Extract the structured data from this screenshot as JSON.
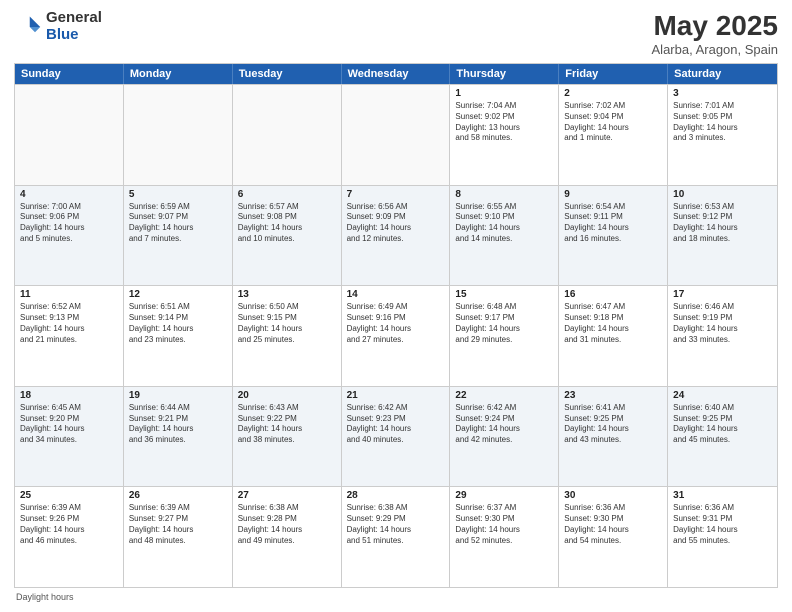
{
  "logo": {
    "general": "General",
    "blue": "Blue"
  },
  "title": "May 2025",
  "subtitle": "Alarba, Aragon, Spain",
  "days": [
    "Sunday",
    "Monday",
    "Tuesday",
    "Wednesday",
    "Thursday",
    "Friday",
    "Saturday"
  ],
  "footer": "Daylight hours",
  "weeks": [
    [
      {
        "day": "",
        "lines": []
      },
      {
        "day": "",
        "lines": []
      },
      {
        "day": "",
        "lines": []
      },
      {
        "day": "",
        "lines": []
      },
      {
        "day": "1",
        "lines": [
          "Sunrise: 7:04 AM",
          "Sunset: 9:02 PM",
          "Daylight: 13 hours",
          "and 58 minutes."
        ]
      },
      {
        "day": "2",
        "lines": [
          "Sunrise: 7:02 AM",
          "Sunset: 9:04 PM",
          "Daylight: 14 hours",
          "and 1 minute."
        ]
      },
      {
        "day": "3",
        "lines": [
          "Sunrise: 7:01 AM",
          "Sunset: 9:05 PM",
          "Daylight: 14 hours",
          "and 3 minutes."
        ]
      }
    ],
    [
      {
        "day": "4",
        "lines": [
          "Sunrise: 7:00 AM",
          "Sunset: 9:06 PM",
          "Daylight: 14 hours",
          "and 5 minutes."
        ]
      },
      {
        "day": "5",
        "lines": [
          "Sunrise: 6:59 AM",
          "Sunset: 9:07 PM",
          "Daylight: 14 hours",
          "and 7 minutes."
        ]
      },
      {
        "day": "6",
        "lines": [
          "Sunrise: 6:57 AM",
          "Sunset: 9:08 PM",
          "Daylight: 14 hours",
          "and 10 minutes."
        ]
      },
      {
        "day": "7",
        "lines": [
          "Sunrise: 6:56 AM",
          "Sunset: 9:09 PM",
          "Daylight: 14 hours",
          "and 12 minutes."
        ]
      },
      {
        "day": "8",
        "lines": [
          "Sunrise: 6:55 AM",
          "Sunset: 9:10 PM",
          "Daylight: 14 hours",
          "and 14 minutes."
        ]
      },
      {
        "day": "9",
        "lines": [
          "Sunrise: 6:54 AM",
          "Sunset: 9:11 PM",
          "Daylight: 14 hours",
          "and 16 minutes."
        ]
      },
      {
        "day": "10",
        "lines": [
          "Sunrise: 6:53 AM",
          "Sunset: 9:12 PM",
          "Daylight: 14 hours",
          "and 18 minutes."
        ]
      }
    ],
    [
      {
        "day": "11",
        "lines": [
          "Sunrise: 6:52 AM",
          "Sunset: 9:13 PM",
          "Daylight: 14 hours",
          "and 21 minutes."
        ]
      },
      {
        "day": "12",
        "lines": [
          "Sunrise: 6:51 AM",
          "Sunset: 9:14 PM",
          "Daylight: 14 hours",
          "and 23 minutes."
        ]
      },
      {
        "day": "13",
        "lines": [
          "Sunrise: 6:50 AM",
          "Sunset: 9:15 PM",
          "Daylight: 14 hours",
          "and 25 minutes."
        ]
      },
      {
        "day": "14",
        "lines": [
          "Sunrise: 6:49 AM",
          "Sunset: 9:16 PM",
          "Daylight: 14 hours",
          "and 27 minutes."
        ]
      },
      {
        "day": "15",
        "lines": [
          "Sunrise: 6:48 AM",
          "Sunset: 9:17 PM",
          "Daylight: 14 hours",
          "and 29 minutes."
        ]
      },
      {
        "day": "16",
        "lines": [
          "Sunrise: 6:47 AM",
          "Sunset: 9:18 PM",
          "Daylight: 14 hours",
          "and 31 minutes."
        ]
      },
      {
        "day": "17",
        "lines": [
          "Sunrise: 6:46 AM",
          "Sunset: 9:19 PM",
          "Daylight: 14 hours",
          "and 33 minutes."
        ]
      }
    ],
    [
      {
        "day": "18",
        "lines": [
          "Sunrise: 6:45 AM",
          "Sunset: 9:20 PM",
          "Daylight: 14 hours",
          "and 34 minutes."
        ]
      },
      {
        "day": "19",
        "lines": [
          "Sunrise: 6:44 AM",
          "Sunset: 9:21 PM",
          "Daylight: 14 hours",
          "and 36 minutes."
        ]
      },
      {
        "day": "20",
        "lines": [
          "Sunrise: 6:43 AM",
          "Sunset: 9:22 PM",
          "Daylight: 14 hours",
          "and 38 minutes."
        ]
      },
      {
        "day": "21",
        "lines": [
          "Sunrise: 6:42 AM",
          "Sunset: 9:23 PM",
          "Daylight: 14 hours",
          "and 40 minutes."
        ]
      },
      {
        "day": "22",
        "lines": [
          "Sunrise: 6:42 AM",
          "Sunset: 9:24 PM",
          "Daylight: 14 hours",
          "and 42 minutes."
        ]
      },
      {
        "day": "23",
        "lines": [
          "Sunrise: 6:41 AM",
          "Sunset: 9:25 PM",
          "Daylight: 14 hours",
          "and 43 minutes."
        ]
      },
      {
        "day": "24",
        "lines": [
          "Sunrise: 6:40 AM",
          "Sunset: 9:25 PM",
          "Daylight: 14 hours",
          "and 45 minutes."
        ]
      }
    ],
    [
      {
        "day": "25",
        "lines": [
          "Sunrise: 6:39 AM",
          "Sunset: 9:26 PM",
          "Daylight: 14 hours",
          "and 46 minutes."
        ]
      },
      {
        "day": "26",
        "lines": [
          "Sunrise: 6:39 AM",
          "Sunset: 9:27 PM",
          "Daylight: 14 hours",
          "and 48 minutes."
        ]
      },
      {
        "day": "27",
        "lines": [
          "Sunrise: 6:38 AM",
          "Sunset: 9:28 PM",
          "Daylight: 14 hours",
          "and 49 minutes."
        ]
      },
      {
        "day": "28",
        "lines": [
          "Sunrise: 6:38 AM",
          "Sunset: 9:29 PM",
          "Daylight: 14 hours",
          "and 51 minutes."
        ]
      },
      {
        "day": "29",
        "lines": [
          "Sunrise: 6:37 AM",
          "Sunset: 9:30 PM",
          "Daylight: 14 hours",
          "and 52 minutes."
        ]
      },
      {
        "day": "30",
        "lines": [
          "Sunrise: 6:36 AM",
          "Sunset: 9:30 PM",
          "Daylight: 14 hours",
          "and 54 minutes."
        ]
      },
      {
        "day": "31",
        "lines": [
          "Sunrise: 6:36 AM",
          "Sunset: 9:31 PM",
          "Daylight: 14 hours",
          "and 55 minutes."
        ]
      }
    ]
  ]
}
